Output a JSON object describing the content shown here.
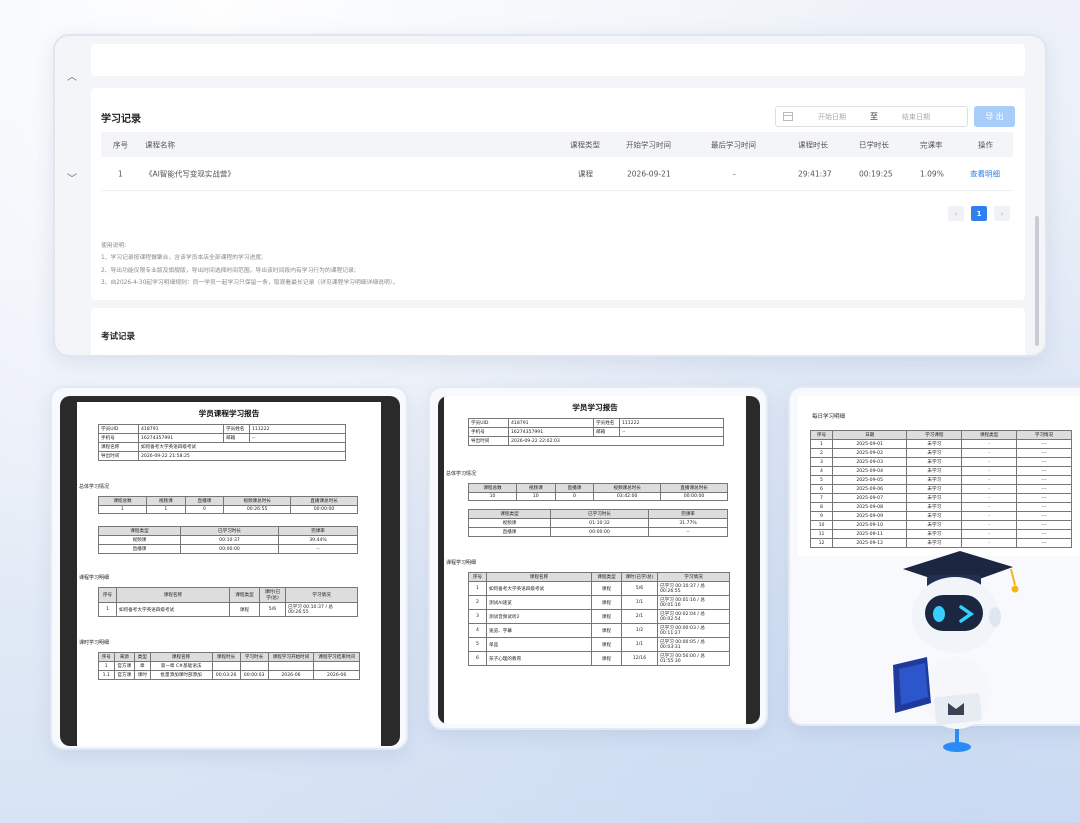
{
  "main": {
    "study_title": "学习记录",
    "date_from_placeholder": "开始日期",
    "date_separator": "至",
    "date_to_placeholder": "结束日期",
    "export_label": "导 出",
    "table": {
      "headers": [
        "序号",
        "课程名称",
        "课程类型",
        "开始学习时间",
        "最后学习时间",
        "课程时长",
        "已学时长",
        "完课率",
        "操作"
      ],
      "row": {
        "no": "1",
        "name": "《AI智能代写变现实战营》",
        "type": "课程",
        "start": "2026-09-21",
        "last": "-",
        "duration": "29:41:37",
        "learned": "00:19:25",
        "rate": "1.09%",
        "action": "查看明细"
      }
    },
    "pager": {
      "prev": "‹",
      "page": "1",
      "next": "›"
    },
    "notes": {
      "heading": "使用说明:",
      "l1": "1、学习记录按课程做聚合，含该学员本店全部课程的学习进度;",
      "l2": "2、导出功能仅限专业版及旗舰版，导出时间选择时间范围，导出该时间段内有学习行为的课程记录;",
      "l3": "3、自2026-4-30起学习明细规则：同一学员一起学习只保留一条，取观看最长记录（详见课程学习明细详细说明）。"
    },
    "exam_title": "考试记录"
  },
  "report1": {
    "title": "学员课程学习报告",
    "info": {
      "uid_l": "学员UID",
      "uid": "418791",
      "name_l": "学员姓名",
      "name": "111222",
      "phone_l": "手机号",
      "phone": "16274357991",
      "mail_l": "邮箱",
      "mail": "--",
      "course_l": "课程名称",
      "course": "如何备考大学英语四级考试",
      "time_l": "导出时间",
      "time": "2026-09-22 21:58:25"
    },
    "overall_title": "总体学习情况",
    "overall_h": [
      "课程总数",
      "视频课",
      "直播课",
      "视频课总时长",
      "直播课总时长"
    ],
    "overall_v": [
      "1",
      "1",
      "0",
      "00:26:55",
      "00:00:00"
    ],
    "type_h": [
      "课程类型",
      "已学习时长",
      "完课率"
    ],
    "type_rows": [
      [
        "视频课",
        "00:10:37",
        "39.44%"
      ],
      [
        "直播课",
        "00:00:00",
        "--"
      ]
    ],
    "detail_title": "课程学习明细",
    "detail_h": [
      "序号",
      "课程名称",
      "课程类型",
      "课时(已学/总)",
      "学习情况"
    ],
    "detail_row": [
      "1",
      "如何备考大学英语四级考试",
      "课程",
      "5/6",
      "已学习 00:10:37 / 总 00:26:55"
    ],
    "lesson_title": "课时学习明细",
    "lesson_h": [
      "序号",
      "来源",
      "类型",
      "课程名称",
      "课程时长",
      "学习时长",
      "课程学习开始时间",
      "课程学习结束时间"
    ],
    "lesson_rows": [
      [
        "1",
        "官方课",
        "章",
        "第一章 C#基础语法",
        "",
        "",
        "",
        ""
      ],
      [
        "1.1",
        "官方课",
        "课时",
        "批量添加课时部添加",
        "00:03:26",
        "00:00:03",
        "2026-06",
        "2026-06"
      ]
    ]
  },
  "report2": {
    "title": "学员学习报告",
    "info": {
      "uid_l": "学员UID",
      "uid": "418791",
      "name_l": "学员姓名",
      "name": "111222",
      "phone_l": "手机号",
      "phone": "16274357991",
      "mail_l": "邮箱",
      "mail": "--",
      "time_l": "导出时间",
      "time": "2026-09-22 22:02:03"
    },
    "overall_title": "总体学习情况",
    "overall_h": [
      "课程总数",
      "视频课",
      "直播课",
      "视频课总时长",
      "直播课总时长"
    ],
    "overall_v": [
      "10",
      "10",
      "0",
      "03:42:00",
      "00:00:00"
    ],
    "type_h": [
      "课程类型",
      "已学习时长",
      "完课率"
    ],
    "type_rows": [
      [
        "视频课",
        "01:10:32",
        "31.77%"
      ],
      [
        "直播课",
        "00:00:00",
        "--"
      ]
    ],
    "detail_title": "课程学习明细",
    "detail_h": [
      "序号",
      "课程名称",
      "课程类型",
      "课时(已学/总)",
      "学习情况"
    ],
    "detail_rows": [
      [
        "1",
        "如何备考大学英语四级考试",
        "课程",
        "5/6",
        "已学习 00:10:37 / 总 00:26:55"
      ],
      [
        "2",
        "测试AI速览",
        "课程",
        "1/1",
        "已学习 00:01:16 / 总 00:01:16"
      ],
      [
        "3",
        "测试音频试听2",
        "课程",
        "2/1",
        "已学习 00:02:04 / 总 00:02:54"
      ],
      [
        "4",
        "速览、字幕",
        "课程",
        "1/2",
        "已学习 00:00:03 / 总 00:11:27"
      ],
      [
        "5",
        "单品",
        "课程",
        "1/1",
        "已学习 00:00:05 / 总 00:03:31"
      ],
      [
        "6",
        "孩子心理的教育",
        "课程",
        "12/16",
        "已学习 00:56:00 / 总 01:55:30"
      ]
    ]
  },
  "report3": {
    "title": "每日学习明细",
    "headers": [
      "序号",
      "日期",
      "学习课程",
      "课程类型",
      "学习情况"
    ],
    "rows": [
      [
        "1",
        "2025-09-01",
        "未学习",
        "-",
        "---"
      ],
      [
        "2",
        "2025-09-02",
        "未学习",
        "-",
        "---"
      ],
      [
        "3",
        "2025-09-03",
        "未学习",
        "-",
        "---"
      ],
      [
        "4",
        "2025-09-04",
        "未学习",
        "-",
        "---"
      ],
      [
        "5",
        "2025-09-05",
        "未学习",
        "-",
        "---"
      ],
      [
        "6",
        "2025-09-06",
        "未学习",
        "-",
        "---"
      ],
      [
        "7",
        "2025-09-07",
        "未学习",
        "-",
        "---"
      ],
      [
        "8",
        "2025-09-08",
        "未学习",
        "-",
        "---"
      ],
      [
        "9",
        "2025-09-09",
        "未学习",
        "-",
        "---"
      ],
      [
        "10",
        "2025-09-10",
        "未学习",
        "-",
        "---"
      ],
      [
        "11",
        "2025-09-11",
        "未学习",
        "-",
        "---"
      ],
      [
        "12",
        "2025-09-12",
        "未学习",
        "-",
        "---"
      ]
    ]
  },
  "colors": {
    "accent": "#2f80ed",
    "export_btn": "#a9cdfb",
    "robot_eye": "#35d0ff"
  }
}
